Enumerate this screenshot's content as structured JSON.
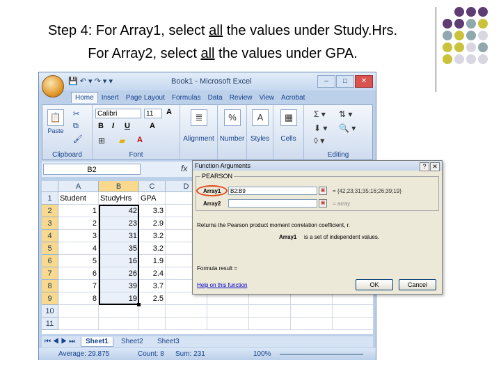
{
  "slide": {
    "line1_prefix": "Step 4: For Array1, select ",
    "line1_underline": "all",
    "line1_suffix": " the values under Study.Hrs.",
    "line2_prefix": "For Array2, select ",
    "line2_underline": "all",
    "line2_suffix": " the values under GPA.",
    "decor_colors": [
      "#5e3c74",
      "#8fa8ae",
      "#c9c23a",
      "#d8d6e2"
    ]
  },
  "window": {
    "title": "Book1 - Microsoft Excel",
    "qat_icons": [
      "save-icon",
      "undo-icon",
      "redo-icon"
    ],
    "qat_glyphs": "💾 ↶ ▾ ↷ ▾ ▾"
  },
  "ribbon": {
    "tabs": [
      "Home",
      "Insert",
      "Page Layout",
      "Formulas",
      "Data",
      "Review",
      "View",
      "Acrobat"
    ],
    "groups": {
      "clipboard": "Clipboard",
      "font": "Font",
      "editing": "Editing"
    },
    "paste_label": "Paste",
    "font_name": "Calibri",
    "font_size": "11",
    "bold": "B",
    "italic": "I",
    "underline": "U",
    "alignment_label": "Alignment",
    "number_label": "Number",
    "styles_label": "Styles",
    "cells_label": "Cells"
  },
  "formula_bar": {
    "name_box": "B2",
    "fx": "fx"
  },
  "sheet": {
    "columns": [
      "A",
      "B",
      "C",
      "D"
    ],
    "headers": [
      "Student",
      "StudyHrs",
      "GPA"
    ],
    "rows": [
      {
        "student": "1",
        "study": "42",
        "gpa": "3.3"
      },
      {
        "student": "2",
        "study": "23",
        "gpa": "2.9"
      },
      {
        "student": "3",
        "study": "31",
        "gpa": "3.2"
      },
      {
        "student": "4",
        "study": "35",
        "gpa": "3.2"
      },
      {
        "student": "5",
        "study": "16",
        "gpa": "1.9"
      },
      {
        "student": "6",
        "study": "26",
        "gpa": "2.4"
      },
      {
        "student": "7",
        "study": "39",
        "gpa": "3.7"
      },
      {
        "student": "8",
        "study": "19",
        "gpa": "2.5"
      }
    ],
    "row_numbers": [
      "1",
      "2",
      "3",
      "4",
      "5",
      "6",
      "7",
      "8",
      "9",
      "10",
      "11"
    ],
    "tabs": [
      "Sheet1",
      "Sheet2",
      "Sheet3"
    ]
  },
  "status": {
    "average": "Average: 29.875",
    "count": "Count: 8",
    "sum": "Sum: 231",
    "zoom": "100%"
  },
  "dialog": {
    "title": "Function Arguments",
    "function_name": "PEARSON",
    "array1_label": "Array1",
    "array1_value": "B2:B9",
    "array1_result": "= {42;23;31;35;16;26;39;19}",
    "array2_label": "Array2",
    "array2_result": "= array",
    "description": "Returns the Pearson product moment correlation coefficient, r.",
    "arg_desc_label": "Array1",
    "arg_desc": "is a set of independent values.",
    "formula_result": "Formula result =",
    "help_link": "Help on this function",
    "ok": "OK",
    "cancel": "Cancel"
  }
}
